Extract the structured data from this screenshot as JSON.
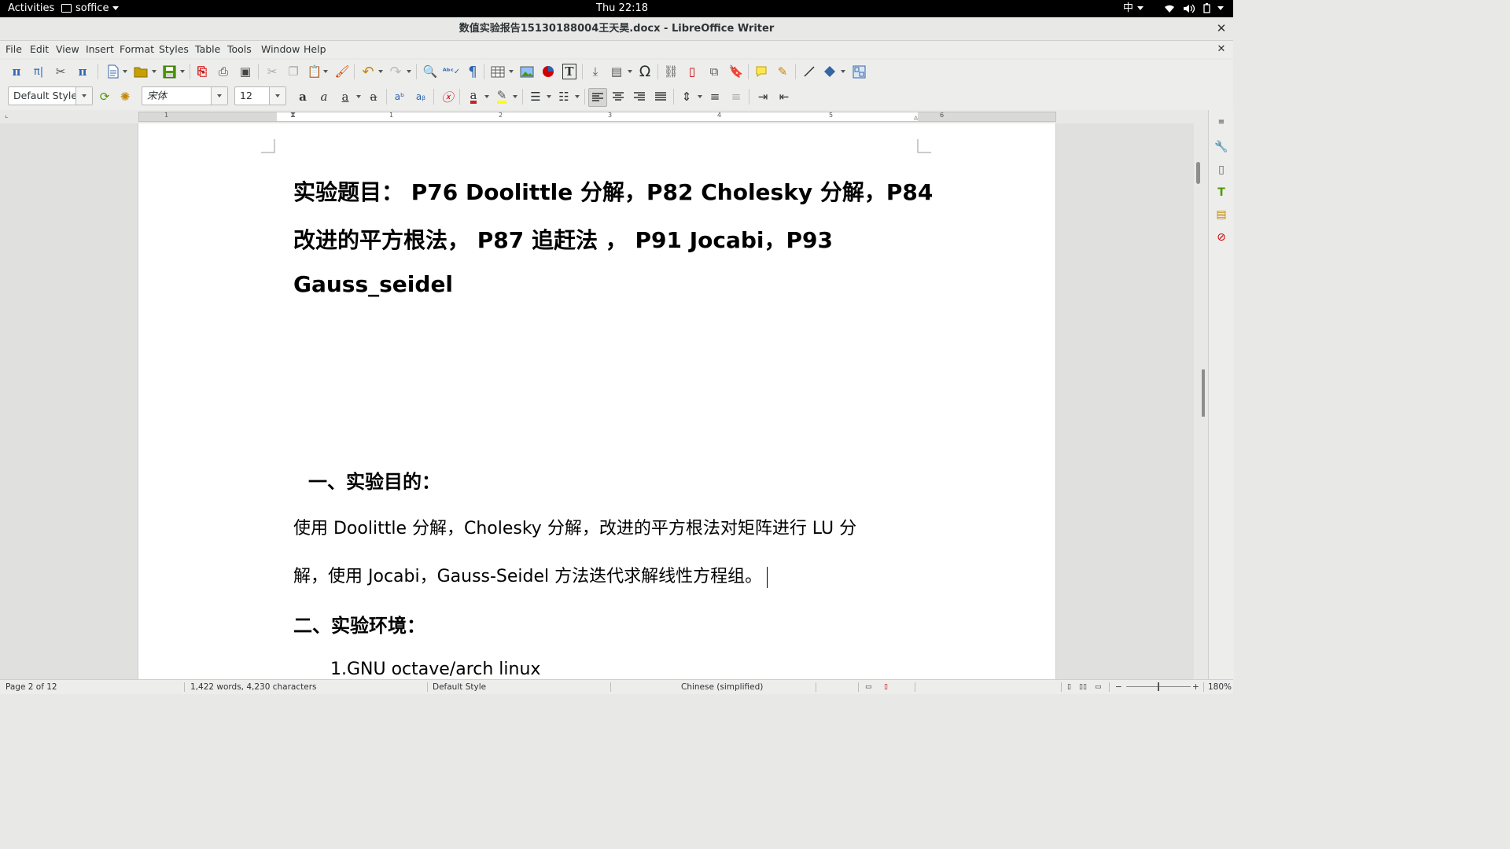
{
  "topbar": {
    "activities": "Activities",
    "app_menu": "soffice",
    "clock": "Thu 22:18",
    "input_method": "中"
  },
  "window": {
    "title": "数值实验报告15130188004王天昊.docx - LibreOffice Writer"
  },
  "menubar": {
    "file": "File",
    "edit": "Edit",
    "view": "View",
    "insert": "Insert",
    "format": "Format",
    "styles": "Styles",
    "table": "Table",
    "tools": "Tools",
    "window": "Window",
    "help": "Help"
  },
  "formatting": {
    "paragraph_style": "Default Style",
    "font_name": "宋体",
    "font_size": "12"
  },
  "ruler": {
    "labels": [
      "1",
      "1",
      "2",
      "3",
      "4",
      "5",
      "6"
    ]
  },
  "document": {
    "title_line1": "实验题目： P76 Doolittle 分解，P82 Cholesky 分解，P84",
    "title_line2": "改进的平方根法， P87 追赶法 ， P91 Jocabi，P93",
    "title_line3": "Gauss_seidel",
    "section1_heading": "一、实验目的：",
    "section1_line1": "使用 Doolittle 分解，Cholesky 分解，改进的平方根法对矩阵进行 LU 分",
    "section1_line2": "解，使用 Jocabi，Gauss-Seidel 方法迭代求解线性方程组。",
    "section2_heading": "二、实验环境：",
    "section2_item1": "1.GNU octave/arch linux"
  },
  "statusbar": {
    "page": "Page 2 of 12",
    "word_count": "1,422 words, 4,230 characters",
    "page_style": "Default Style",
    "language": "Chinese (simplified)",
    "zoom": "180%"
  },
  "colors": {
    "topbar_bg": "#000000",
    "window_bg": "#ededec",
    "document_bg": "#e0e0de",
    "page_bg": "#ffffff",
    "font_color_red": "#c9211e",
    "highlight_yellow": "#ffff00"
  }
}
